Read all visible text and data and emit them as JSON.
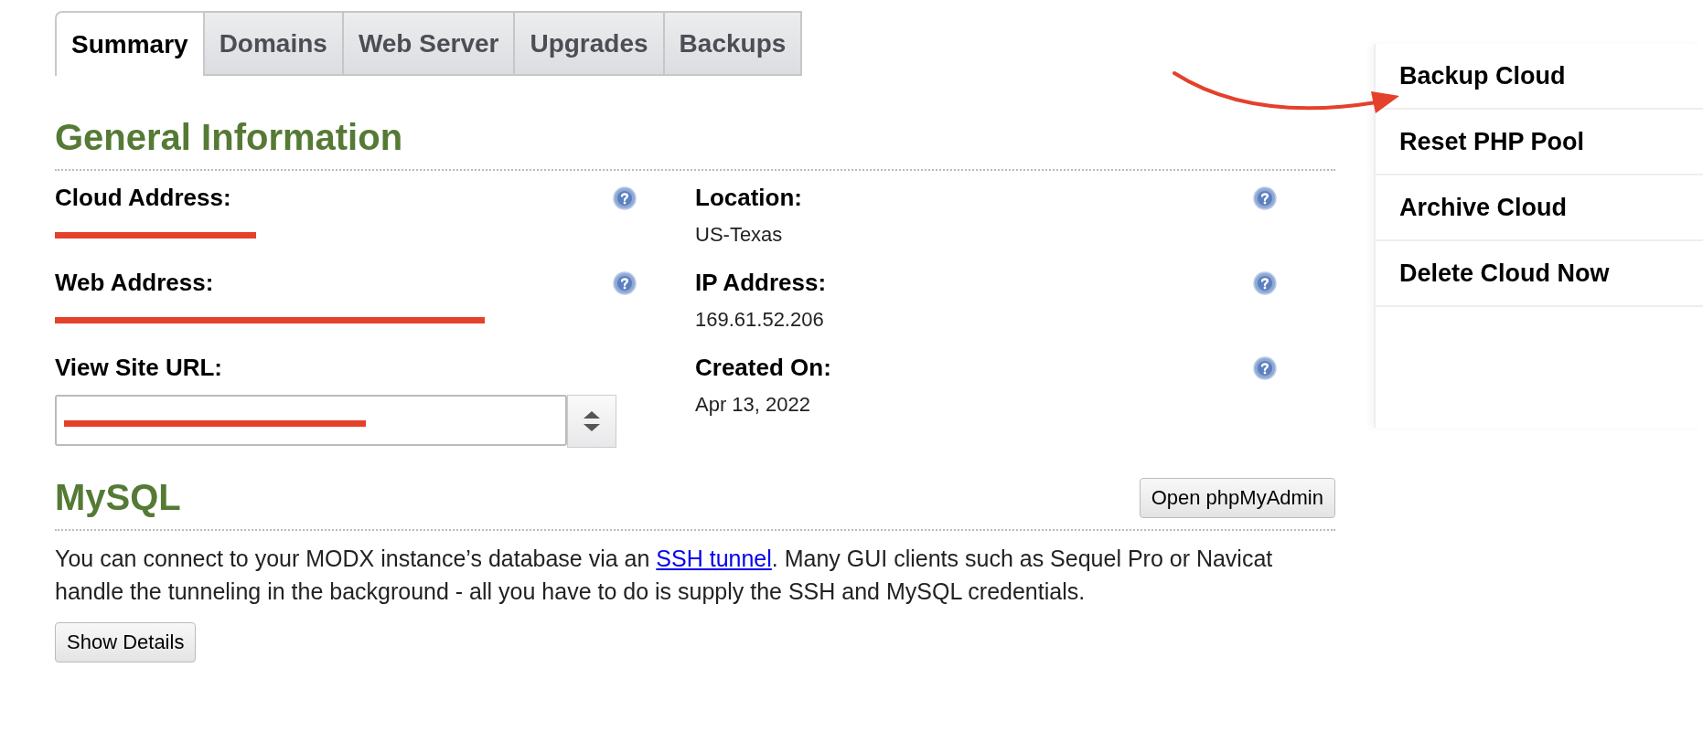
{
  "tabs": [
    {
      "label": "Summary",
      "selected": true
    },
    {
      "label": "Domains",
      "selected": false
    },
    {
      "label": "Web Server",
      "selected": false
    },
    {
      "label": "Upgrades",
      "selected": false
    },
    {
      "label": "Backups",
      "selected": false
    }
  ],
  "general": {
    "heading": "General Information",
    "left": [
      {
        "kind": "redacted",
        "label": "Cloud Address:",
        "help": true
      },
      {
        "kind": "redacted",
        "label": "Web Address:",
        "help": true
      },
      {
        "kind": "select",
        "label": "View Site URL:",
        "help": false
      }
    ],
    "right": [
      {
        "kind": "text",
        "label": "Location:",
        "value": "US-Texas",
        "help": true
      },
      {
        "kind": "text",
        "label": "IP Address:",
        "value": "169.61.52.206",
        "help": true
      },
      {
        "kind": "text",
        "label": "Created On:",
        "value": "Apr 13, 2022",
        "help": true
      }
    ]
  },
  "mysql": {
    "heading": "MySQL",
    "button": "Open phpMyAdmin",
    "text_before": "You can connect to your MODX instance’s database via an ",
    "link": "SSH tunnel",
    "text_after": ". Many GUI clients such as Sequel Pro or Navicat handle the tunneling in the background - all you have to do is supply the SSH and MySQL credentials.",
    "details_button": "Show Details"
  },
  "actions": [
    {
      "label": "Backup Cloud"
    },
    {
      "label": "Reset PHP Pool"
    },
    {
      "label": "Archive Cloud"
    },
    {
      "label": "Delete Cloud Now"
    }
  ]
}
